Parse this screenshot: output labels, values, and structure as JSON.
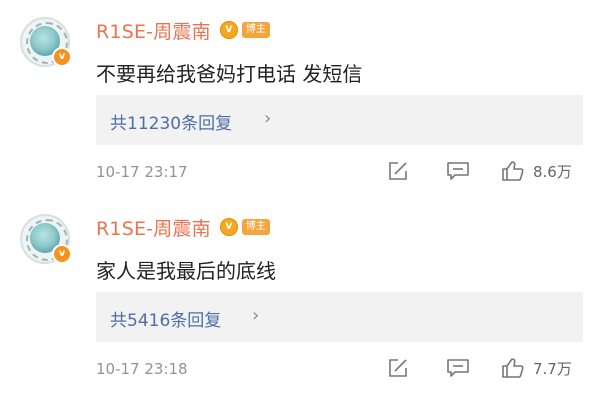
{
  "comments": [
    {
      "username": "R1SE-周震南",
      "level_badge": "V",
      "role_badge": "博主",
      "verified_mark": "v",
      "content": "不要再给我爸妈打电话 发短信",
      "replies": "共11230条回复",
      "replies_arrow": "›",
      "time": "10-17 23:17",
      "likes": "8.6万"
    },
    {
      "username": "R1SE-周震南",
      "level_badge": "V",
      "role_badge": "博主",
      "verified_mark": "v",
      "content": "家人是我最后的底线",
      "replies": "共5416条回复",
      "replies_arrow": "›",
      "time": "10-17 23:18",
      "likes": "7.7万"
    }
  ],
  "colors": {
    "username": "#eb7350",
    "link": "#4e6ea7",
    "badge": "#f6a53c",
    "reply_bg": "#f2f2f2",
    "meta": "#939393"
  }
}
